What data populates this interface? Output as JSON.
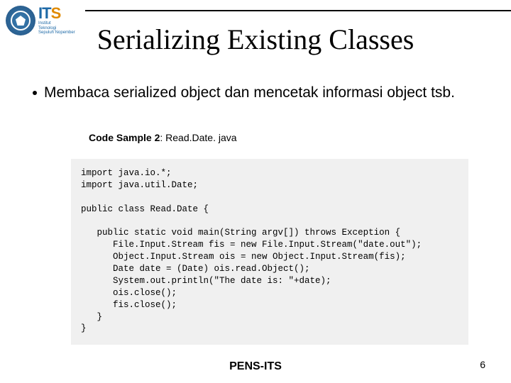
{
  "logo": {
    "acronym_i": "I",
    "acronym_t": "T",
    "acronym_s": "S",
    "sub1": "Institut",
    "sub2": "Teknologi",
    "sub3": "Sepuluh Nopember"
  },
  "title": "Serializing Existing Classes",
  "bullet": "Membaca serialized object dan mencetak informasi object tsb.",
  "sample": {
    "label_bold": "Code Sample 2",
    "label_rest": ": Read.Date. java"
  },
  "code": "import java.io.*;\nimport java.util.Date;\n\npublic class Read.Date {\n\n   public static void main(String argv[]) throws Exception {\n      File.Input.Stream fis = new File.Input.Stream(\"date.out\");\n      Object.Input.Stream ois = new Object.Input.Stream(fis);\n      Date date = (Date) ois.read.Object();\n      System.out.println(\"The date is: \"+date);\n      ois.close();\n      fis.close();\n   }\n}",
  "footer": "PENS-ITS",
  "page_number": "6"
}
